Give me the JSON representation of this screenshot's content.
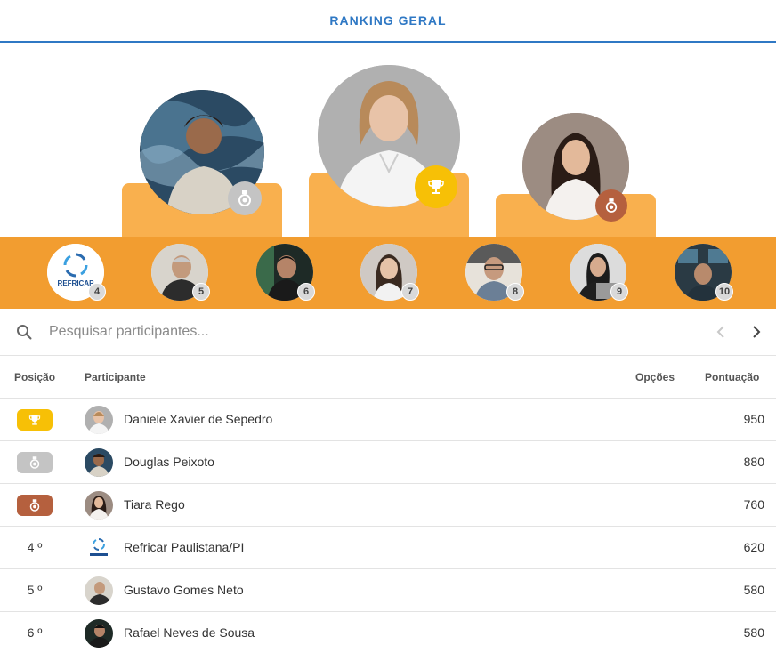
{
  "header": {
    "title": "RANKING GERAL"
  },
  "colors": {
    "accent": "#2f78c4",
    "podium": "#f9b04e",
    "strip": "#f29d30",
    "gold": "#f7c006",
    "silver": "#c4c4c4",
    "bronze": "#b5603e"
  },
  "podium": [
    {
      "place": 2,
      "badge_icon": "medal-icon",
      "name": "Douglas Peixoto"
    },
    {
      "place": 1,
      "badge_icon": "trophy-icon",
      "name": "Daniele Xavier de Sepedro"
    },
    {
      "place": 3,
      "badge_icon": "medal-icon",
      "name": "Tiara Rego"
    }
  ],
  "strip": [
    {
      "rank": "4",
      "logo_text": "REFRICAP"
    },
    {
      "rank": "5"
    },
    {
      "rank": "6"
    },
    {
      "rank": "7"
    },
    {
      "rank": "8"
    },
    {
      "rank": "9"
    },
    {
      "rank": "10"
    }
  ],
  "search": {
    "placeholder": "Pesquisar participantes..."
  },
  "table": {
    "headers": {
      "position": "Posição",
      "participant": "Participante",
      "options": "Opções",
      "score": "Pontuação"
    },
    "rows": [
      {
        "position": "",
        "badge": "gold",
        "name": "Daniele Xavier de Sepedro",
        "score": "950"
      },
      {
        "position": "",
        "badge": "silver",
        "name": "Douglas Peixoto",
        "score": "880"
      },
      {
        "position": "",
        "badge": "bronze",
        "name": "Tiara Rego",
        "score": "760"
      },
      {
        "position": "4 º",
        "badge": "",
        "name": "Refricar Paulistana/PI",
        "score": "620"
      },
      {
        "position": "5 º",
        "badge": "",
        "name": "Gustavo Gomes Neto",
        "score": "580"
      },
      {
        "position": "6 º",
        "badge": "",
        "name": "Rafael Neves de Sousa",
        "score": "580"
      }
    ]
  }
}
